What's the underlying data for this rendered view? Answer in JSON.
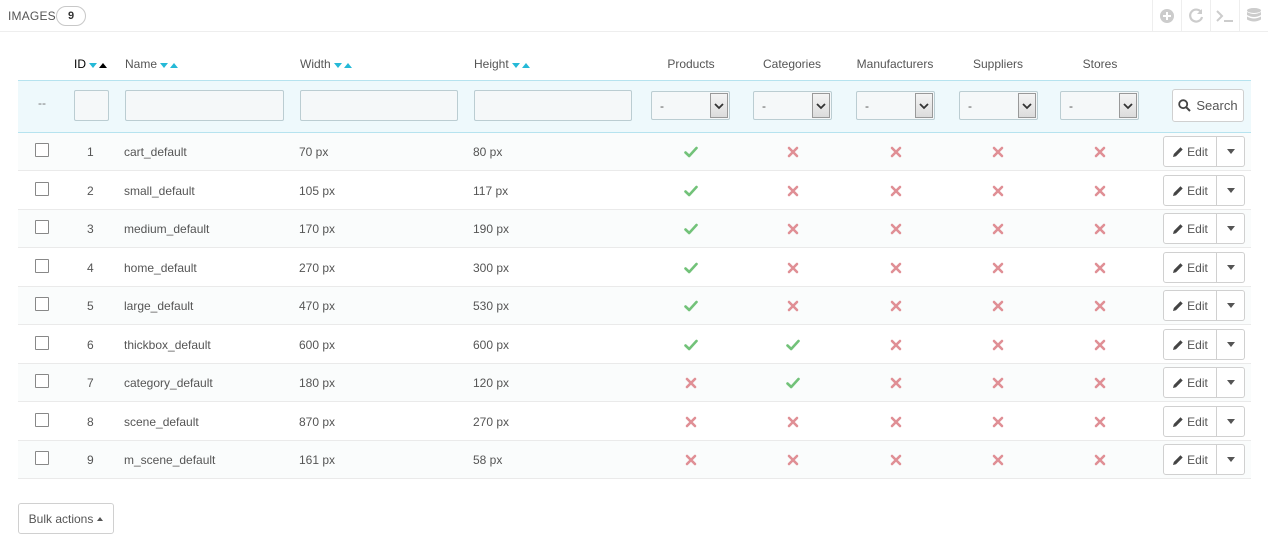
{
  "panel": {
    "title": "IMAGES",
    "count": "9",
    "toolbar": [
      {
        "icon": "plus-circle-icon"
      },
      {
        "icon": "refresh-icon"
      },
      {
        "icon": "terminal-icon"
      },
      {
        "icon": "database-icon"
      }
    ]
  },
  "table": {
    "headers": {
      "id": "ID",
      "name": "Name",
      "width": "Width",
      "height": "Height",
      "products": "Products",
      "categories": "Categories",
      "manufacturers": "Manufacturers",
      "suppliers": "Suppliers",
      "stores": "Stores"
    },
    "filters": {
      "dash": "--",
      "select_value": "-",
      "search_label": "Search"
    },
    "rows": [
      {
        "id": "1",
        "name": "cart_default",
        "width": "70 px",
        "height": "80 px",
        "products": true,
        "categories": false,
        "manufacturers": false,
        "suppliers": false,
        "stores": false
      },
      {
        "id": "2",
        "name": "small_default",
        "width": "105 px",
        "height": "117 px",
        "products": true,
        "categories": false,
        "manufacturers": false,
        "suppliers": false,
        "stores": false
      },
      {
        "id": "3",
        "name": "medium_default",
        "width": "170 px",
        "height": "190 px",
        "products": true,
        "categories": false,
        "manufacturers": false,
        "suppliers": false,
        "stores": false
      },
      {
        "id": "4",
        "name": "home_default",
        "width": "270 px",
        "height": "300 px",
        "products": true,
        "categories": false,
        "manufacturers": false,
        "suppliers": false,
        "stores": false
      },
      {
        "id": "5",
        "name": "large_default",
        "width": "470 px",
        "height": "530 px",
        "products": true,
        "categories": false,
        "manufacturers": false,
        "suppliers": false,
        "stores": false
      },
      {
        "id": "6",
        "name": "thickbox_default",
        "width": "600 px",
        "height": "600 px",
        "products": true,
        "categories": true,
        "manufacturers": false,
        "suppliers": false,
        "stores": false
      },
      {
        "id": "7",
        "name": "category_default",
        "width": "180 px",
        "height": "120 px",
        "products": false,
        "categories": true,
        "manufacturers": false,
        "suppliers": false,
        "stores": false
      },
      {
        "id": "8",
        "name": "scene_default",
        "width": "870 px",
        "height": "270 px",
        "products": false,
        "categories": false,
        "manufacturers": false,
        "suppliers": false,
        "stores": false
      },
      {
        "id": "9",
        "name": "m_scene_default",
        "width": "161 px",
        "height": "58 px",
        "products": false,
        "categories": false,
        "manufacturers": false,
        "suppliers": false,
        "stores": false
      }
    ],
    "edit_label": "Edit"
  },
  "bulk_actions_label": "Bulk actions",
  "colors": {
    "check": "#72c279",
    "cross": "#e08f95",
    "accent": "#25b9d7"
  }
}
